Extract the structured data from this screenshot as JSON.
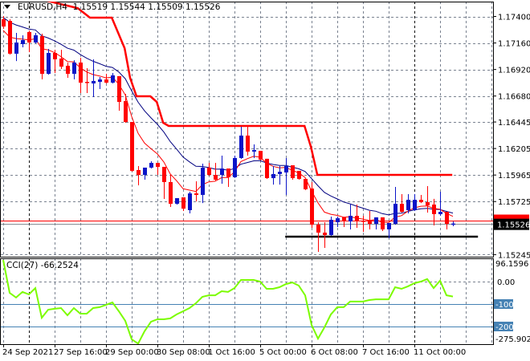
{
  "header": {
    "symbol": "EURUSD,H4",
    "open": "1.15519",
    "high": "1.15544",
    "low": "1.15509",
    "close": "1.15526",
    "menu_icon": "triangle-down-icon"
  },
  "colors": {
    "bull": "#0a14c8",
    "bear": "#ff0000",
    "ma_slow": "#000080",
    "ma_fast": "#ff0000",
    "step_line": "#ff0000",
    "support_line": "#000000",
    "cci": "#7cfc00",
    "cci_levels": "#4682b4",
    "grid": "#7a8290"
  },
  "chart_data": [
    {
      "type": "candlestick",
      "title": "EURUSD,H4",
      "ylim": [
        1.152,
        1.17549
      ],
      "y_ticks": [
        "1.17400",
        "1.17160",
        "1.16920",
        "1.16680",
        "1.16445",
        "1.16205",
        "1.15965",
        "1.15725",
        "1.15245"
      ],
      "x_tick_labels": [
        "24 Sep 2021",
        "27 Sep 16:00",
        "29 Sep 00:00",
        "30 Sep 08:00",
        "1 Oct 16:00",
        "5 Oct 00:00",
        "6 Oct 08:00",
        "7 Oct 16:00",
        "11 Oct 00:00"
      ],
      "x_tick_every_bars": 8,
      "current_price": "1.15526",
      "ask_price": 1.15549,
      "ohlc": [
        [
          1.17375,
          1.17404,
          1.17295,
          1.17309
        ],
        [
          1.1736,
          1.17375,
          1.17063,
          1.17063
        ],
        [
          1.17063,
          1.17251,
          1.17004,
          1.17164
        ],
        [
          1.1715,
          1.1723,
          1.17128,
          1.17186
        ],
        [
          1.17259,
          1.17273,
          1.17084,
          1.17164
        ],
        [
          1.17164,
          1.17251,
          1.17164,
          1.1723
        ],
        [
          1.17222,
          1.17244,
          1.16838,
          1.16881
        ],
        [
          1.16881,
          1.17106,
          1.16881,
          1.1707
        ],
        [
          1.1707,
          1.17099,
          1.16896,
          1.17012
        ],
        [
          1.17019,
          1.17099,
          1.16932,
          1.16946
        ],
        [
          1.16954,
          1.16983,
          1.16852,
          1.16881
        ],
        [
          1.16881,
          1.17004,
          1.16838,
          1.16983
        ],
        [
          1.16983,
          1.17026,
          1.16714,
          1.16801
        ],
        [
          1.16808,
          1.16932,
          1.16714,
          1.16801
        ],
        [
          1.16794,
          1.17012,
          1.16678,
          1.16816
        ],
        [
          1.16808,
          1.16852,
          1.1675,
          1.1683
        ],
        [
          1.1683,
          1.16881,
          1.16801,
          1.16801
        ],
        [
          1.16801,
          1.16888,
          1.16801,
          1.16867
        ],
        [
          1.1686,
          1.1686,
          1.16554,
          1.16627
        ],
        [
          1.16634,
          1.167,
          1.16445,
          1.16445
        ],
        [
          1.16445,
          1.16445,
          1.16003,
          1.16003
        ],
        [
          1.1601,
          1.16046,
          1.15879,
          1.15966
        ],
        [
          1.15966,
          1.16032,
          1.1593,
          1.16032
        ],
        [
          1.16032,
          1.1609,
          1.16032,
          1.16075
        ],
        [
          1.16075,
          1.16075,
          1.15974,
          1.16039
        ],
        [
          1.16039,
          1.16039,
          1.15756,
          1.15901
        ],
        [
          1.15901,
          1.15966,
          1.15683,
          1.15705
        ],
        [
          1.15705,
          1.15756,
          1.15705,
          1.15756
        ],
        [
          1.15763,
          1.15763,
          1.15647,
          1.15661
        ],
        [
          1.15647,
          1.15814,
          1.15625,
          1.15799
        ],
        [
          1.15799,
          1.15908,
          1.15734,
          1.15785
        ],
        [
          1.15785,
          1.16068,
          1.15719,
          1.16032
        ],
        [
          1.16032,
          1.16075,
          1.15966,
          1.15966
        ],
        [
          1.15966,
          1.16075,
          1.15923,
          1.15923
        ],
        [
          1.15966,
          1.16141,
          1.15894,
          1.16024
        ],
        [
          1.16024,
          1.16024,
          1.15865,
          1.15945
        ],
        [
          1.15945,
          1.16141,
          1.15945,
          1.16119
        ],
        [
          1.16119,
          1.16402,
          1.16119,
          1.16322
        ],
        [
          1.16322,
          1.16402,
          1.16148,
          1.16177
        ],
        [
          1.16177,
          1.16242,
          1.16126,
          1.16191
        ],
        [
          1.16184,
          1.16184,
          1.16104,
          1.16104
        ],
        [
          1.16112,
          1.16112,
          1.15937,
          1.15937
        ],
        [
          1.15937,
          1.16046,
          1.15886,
          1.15974
        ],
        [
          1.15974,
          1.16046,
          1.15886,
          1.15995
        ],
        [
          1.15988,
          1.16119,
          1.15792,
          1.16046
        ],
        [
          1.16053,
          1.16053,
          1.1593,
          1.15937
        ],
        [
          1.16003,
          1.16003,
          1.1593,
          1.1593
        ],
        [
          1.1593,
          1.1593,
          1.15836,
          1.15836
        ],
        [
          1.15843,
          1.15901,
          1.15494,
          1.15516
        ],
        [
          1.15516,
          1.15538,
          1.15277,
          1.15444
        ],
        [
          1.15444,
          1.15538,
          1.15313,
          1.15422
        ],
        [
          1.15422,
          1.15589,
          1.15422,
          1.1556
        ],
        [
          1.15538,
          1.15589,
          1.15502,
          1.15574
        ],
        [
          1.15582,
          1.15582,
          1.15502,
          1.15545
        ],
        [
          1.15545,
          1.15698,
          1.1548,
          1.15596
        ],
        [
          1.15596,
          1.15698,
          1.15494,
          1.15545
        ],
        [
          1.15552,
          1.15596,
          1.15458,
          1.15545
        ],
        [
          1.15545,
          1.1564,
          1.1548,
          1.15523
        ],
        [
          1.15523,
          1.15582,
          1.1548,
          1.15582
        ],
        [
          1.15582,
          1.15582,
          1.15465,
          1.15473
        ],
        [
          1.15473,
          1.15531,
          1.154,
          1.15531
        ],
        [
          1.15523,
          1.15857,
          1.15523,
          1.15705
        ],
        [
          1.15705,
          1.15792,
          1.15632,
          1.15632
        ],
        [
          1.15647,
          1.15792,
          1.15625,
          1.15741
        ],
        [
          1.15647,
          1.15792,
          1.15647,
          1.15741
        ],
        [
          1.15741,
          1.15785,
          1.15719,
          1.15719
        ],
        [
          1.15719,
          1.15865,
          1.15632,
          1.1569
        ],
        [
          1.15698,
          1.15749,
          1.15516,
          1.15611
        ],
        [
          1.15611,
          1.15814,
          1.15603,
          1.15632
        ],
        [
          1.15632,
          1.15632,
          1.1548,
          1.15523
        ],
        [
          1.15519,
          1.15544,
          1.15509,
          1.15526
        ]
      ],
      "step_line": [
        [
          6.4,
          1.17549
        ],
        [
          8.9,
          1.17513
        ],
        [
          11.6,
          1.17476
        ],
        [
          13.5,
          1.17389
        ],
        [
          16.9,
          1.17389
        ],
        [
          18.9,
          1.17113
        ],
        [
          19.75,
          1.16845
        ],
        [
          20.75,
          1.16678
        ],
        [
          22.9,
          1.16678
        ],
        [
          23.9,
          1.16627
        ],
        [
          24.9,
          1.16438
        ],
        [
          25.75,
          1.16409
        ],
        [
          46.9,
          1.16409
        ],
        [
          47.9,
          1.1622
        ],
        [
          48.9,
          1.15966
        ],
        [
          69.9,
          1.15966
        ]
      ],
      "support_line": {
        "from_bar": 43.9,
        "to_bar": 73.9,
        "price": 1.15407
      }
    },
    {
      "type": "line",
      "title": "CCI(27)",
      "last_value": "-66.2524",
      "max_label": "96.1596",
      "min_label": "-275.9025",
      "levels": [
        "0.00",
        "-100",
        "-200"
      ],
      "ylim": [
        -285,
        104
      ],
      "values": [
        96.16,
        -50,
        -71,
        -46,
        -57,
        -29,
        -161,
        -125,
        -121,
        -118,
        -150,
        -118,
        -143,
        -143,
        -118,
        -114,
        -104,
        -93,
        -132,
        -175,
        -257,
        -275.9,
        -221,
        -179,
        -168,
        -168,
        -164,
        -146,
        -132,
        -118,
        -96,
        -68,
        -61,
        -61,
        -43,
        -46,
        -29,
        7,
        7,
        7,
        0,
        -32,
        -32,
        -25,
        -11,
        -4,
        -18,
        -61,
        -193,
        -254,
        -204,
        -146,
        -114,
        -114,
        -89,
        -89,
        -89,
        -82,
        -79,
        -79,
        -79,
        -25,
        -32,
        -21,
        -7,
        0,
        11,
        -29,
        4,
        -61,
        -66.25
      ]
    }
  ]
}
